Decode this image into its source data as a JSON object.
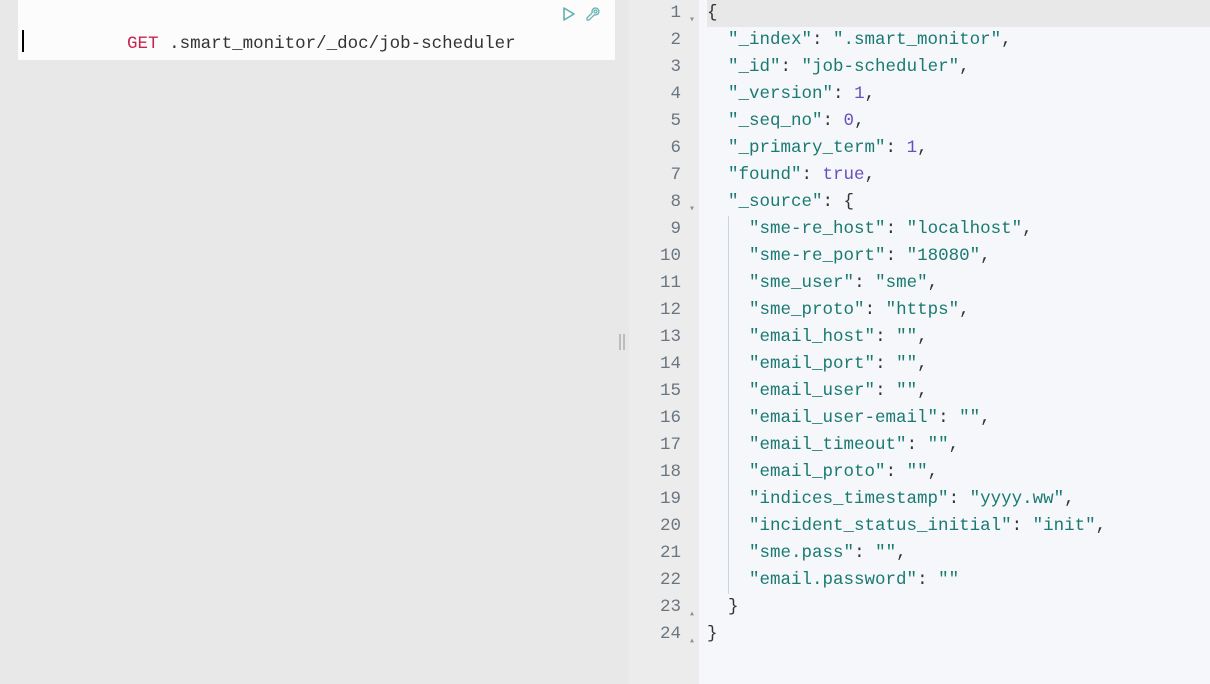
{
  "request": {
    "method": "GET",
    "path": ".smart_monitor/_doc/job-scheduler"
  },
  "icons": {
    "run": "▷",
    "wrench": "🔧"
  },
  "response": {
    "lines": [
      {
        "n": 1,
        "fold": "open",
        "html": "<span class='pun'>{</span>"
      },
      {
        "n": 2,
        "html": "  <span class='key'>\"_index\"</span><span class='pun'>: </span><span class='str'>\".smart_monitor\"</span><span class='pun'>,</span>"
      },
      {
        "n": 3,
        "html": "  <span class='key'>\"_id\"</span><span class='pun'>: </span><span class='str'>\"job-scheduler\"</span><span class='pun'>,</span>"
      },
      {
        "n": 4,
        "html": "  <span class='key'>\"_version\"</span><span class='pun'>: </span><span class='num'>1</span><span class='pun'>,</span>"
      },
      {
        "n": 5,
        "html": "  <span class='key'>\"_seq_no\"</span><span class='pun'>: </span><span class='num'>0</span><span class='pun'>,</span>"
      },
      {
        "n": 6,
        "html": "  <span class='key'>\"_primary_term\"</span><span class='pun'>: </span><span class='num'>1</span><span class='pun'>,</span>"
      },
      {
        "n": 7,
        "html": "  <span class='key'>\"found\"</span><span class='pun'>: </span><span class='bool'>true</span><span class='pun'>,</span>"
      },
      {
        "n": 8,
        "fold": "open",
        "html": "  <span class='key'>\"_source\"</span><span class='pun'>: {</span>"
      },
      {
        "n": 9,
        "bar": true,
        "html": "    <span class='key'>\"sme-re_host\"</span><span class='pun'>: </span><span class='str'>\"localhost\"</span><span class='pun'>,</span>"
      },
      {
        "n": 10,
        "bar": true,
        "html": "    <span class='key'>\"sme-re_port\"</span><span class='pun'>: </span><span class='str'>\"18080\"</span><span class='pun'>,</span>"
      },
      {
        "n": 11,
        "bar": true,
        "html": "    <span class='key'>\"sme_user\"</span><span class='pun'>: </span><span class='str'>\"sme\"</span><span class='pun'>,</span>"
      },
      {
        "n": 12,
        "bar": true,
        "html": "    <span class='key'>\"sme_proto\"</span><span class='pun'>: </span><span class='str'>\"https\"</span><span class='pun'>,</span>"
      },
      {
        "n": 13,
        "bar": true,
        "html": "    <span class='key'>\"email_host\"</span><span class='pun'>: </span><span class='str'>\"\"</span><span class='pun'>,</span>"
      },
      {
        "n": 14,
        "bar": true,
        "html": "    <span class='key'>\"email_port\"</span><span class='pun'>: </span><span class='str'>\"\"</span><span class='pun'>,</span>"
      },
      {
        "n": 15,
        "bar": true,
        "html": "    <span class='key'>\"email_user\"</span><span class='pun'>: </span><span class='str'>\"\"</span><span class='pun'>,</span>"
      },
      {
        "n": 16,
        "bar": true,
        "html": "    <span class='key'>\"email_user-email\"</span><span class='pun'>: </span><span class='str'>\"\"</span><span class='pun'>,</span>"
      },
      {
        "n": 17,
        "bar": true,
        "html": "    <span class='key'>\"email_timeout\"</span><span class='pun'>: </span><span class='str'>\"\"</span><span class='pun'>,</span>"
      },
      {
        "n": 18,
        "bar": true,
        "html": "    <span class='key'>\"email_proto\"</span><span class='pun'>: </span><span class='str'>\"\"</span><span class='pun'>,</span>"
      },
      {
        "n": 19,
        "bar": true,
        "html": "    <span class='key'>\"indices_timestamp\"</span><span class='pun'>: </span><span class='str'>\"yyyy.ww\"</span><span class='pun'>,</span>"
      },
      {
        "n": 20,
        "bar": true,
        "html": "    <span class='key'>\"incident_status_initial\"</span><span class='pun'>: </span><span class='str'>\"init\"</span><span class='pun'>,</span>"
      },
      {
        "n": 21,
        "bar": true,
        "html": "    <span class='key'>\"sme.pass\"</span><span class='pun'>: </span><span class='str'>\"\"</span><span class='pun'>,</span>"
      },
      {
        "n": 22,
        "bar": true,
        "html": "    <span class='key'>\"email.password\"</span><span class='pun'>: </span><span class='str'>\"\"</span>"
      },
      {
        "n": 23,
        "fold": "close",
        "html": "  <span class='pun'>}</span>"
      },
      {
        "n": 24,
        "fold": "close",
        "html": "<span class='pun'>}</span>"
      }
    ]
  },
  "response_raw": {
    "_index": ".smart_monitor",
    "_id": "job-scheduler",
    "_version": 1,
    "_seq_no": 0,
    "_primary_term": 1,
    "found": true,
    "_source": {
      "sme-re_host": "localhost",
      "sme-re_port": "18080",
      "sme_user": "sme",
      "sme_proto": "https",
      "email_host": "",
      "email_port": "",
      "email_user": "",
      "email_user-email": "",
      "email_timeout": "",
      "email_proto": "",
      "indices_timestamp": "yyyy.ww",
      "incident_status_initial": "init",
      "sme.pass": "",
      "email.password": ""
    }
  }
}
